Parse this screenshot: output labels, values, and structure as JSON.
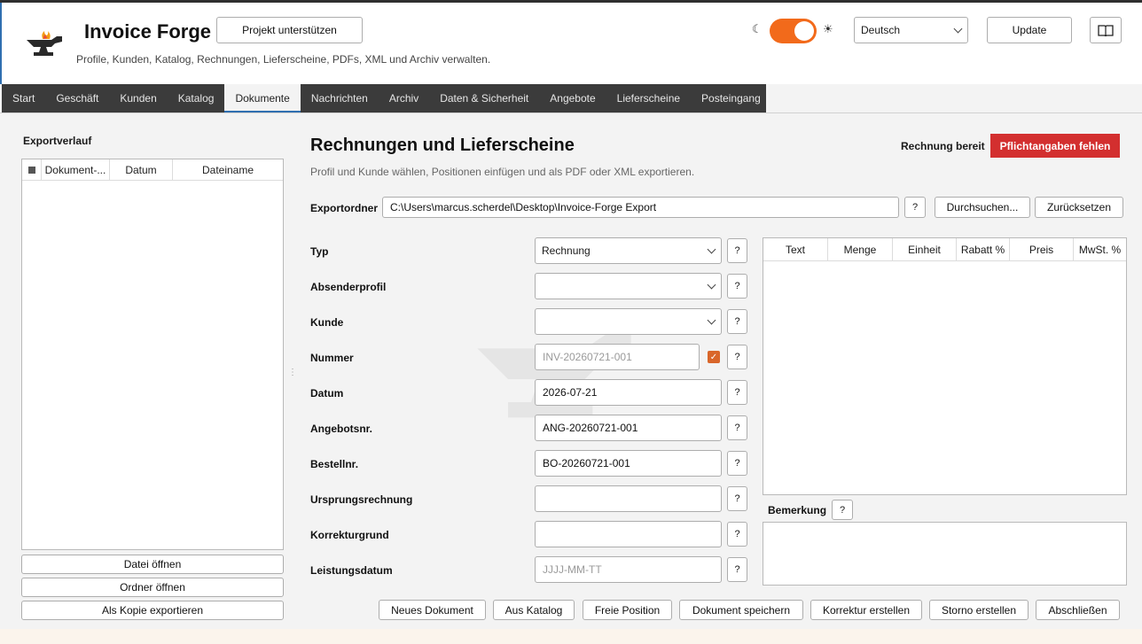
{
  "header": {
    "title": "Invoice Forge",
    "subtitle": "Profile, Kunden, Katalog, Rechnungen, Lieferscheine, PDFs, XML und Archiv verwalten.",
    "support_label": "Projekt unterstützen",
    "theme_toggle_on": true,
    "language": "Deutsch",
    "update_label": "Update",
    "accent_color": "#f26a1b"
  },
  "tabs": [
    {
      "label": "Start"
    },
    {
      "label": "Geschäft"
    },
    {
      "label": "Kunden"
    },
    {
      "label": "Katalog"
    },
    {
      "label": "Dokumente",
      "active": true
    },
    {
      "label": "Nachrichten"
    },
    {
      "label": "Archiv"
    },
    {
      "label": "Daten & Sicherheit"
    },
    {
      "label": "Angebote"
    },
    {
      "label": "Lieferscheine"
    },
    {
      "label": "Posteingang"
    }
  ],
  "history": {
    "title": "Exportverlauf",
    "columns": [
      "Dokument-...",
      "Datum",
      "Dateiname"
    ],
    "open_file_label": "Datei öffnen",
    "open_folder_label": "Ordner öffnen",
    "export_copy_label": "Als Kopie exportieren"
  },
  "main": {
    "title": "Rechnungen und Lieferscheine",
    "subtitle": "Profil und Kunde wählen, Positionen einfügen und als PDF oder XML exportieren.",
    "status_label": "Rechnung bereit",
    "status_badge": "Pflichtangaben fehlen",
    "status_color": "#d32f2f",
    "export_folder_label": "Exportordner",
    "export_folder_value": "C:\\Users\\marcus.scherdel\\Desktop\\Invoice-Forge Export",
    "browse_label": "Durchsuchen...",
    "reset_label": "Zurücksetzen",
    "help_label": "?"
  },
  "form": {
    "type": {
      "label": "Typ",
      "value": "Rechnung"
    },
    "sender": {
      "label": "Absenderprofil",
      "value": ""
    },
    "customer": {
      "label": "Kunde",
      "value": ""
    },
    "number": {
      "label": "Nummer",
      "placeholder": "INV-20260721-001",
      "auto_checked": true
    },
    "date": {
      "label": "Datum",
      "value": "2026-07-21"
    },
    "offer_no": {
      "label": "Angebotsnr.",
      "value": "ANG-20260721-001"
    },
    "order_no": {
      "label": "Bestellnr.",
      "value": "BO-20260721-001"
    },
    "origin_invoice": {
      "label": "Ursprungsrechnung",
      "value": ""
    },
    "correction_reason": {
      "label": "Korrekturgrund",
      "value": ""
    },
    "service_date": {
      "label": "Leistungsdatum",
      "placeholder": "JJJJ-MM-TT"
    }
  },
  "positions": {
    "columns": [
      "Text",
      "Menge",
      "Einheit",
      "Rabatt %",
      "Preis",
      "MwSt. %"
    ]
  },
  "remark": {
    "label": "Bemerkung"
  },
  "actions": {
    "new_doc": "Neues Dokument",
    "from_catalog": "Aus Katalog",
    "free_position": "Freie Position",
    "save_doc": "Dokument speichern",
    "create_correction": "Korrektur erstellen",
    "create_cancellation": "Storno erstellen",
    "finish": "Abschließen"
  }
}
